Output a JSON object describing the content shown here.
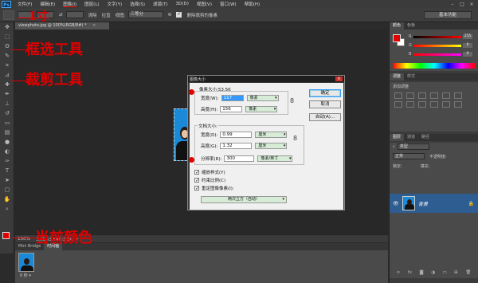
{
  "menubar": {
    "logo": "Ps",
    "items": [
      "文件(F)",
      "编辑(E)",
      "图像(I)",
      "图层(L)",
      "文字(Y)",
      "选择(S)",
      "滤镜(T)",
      "3D(D)",
      "视图(V)",
      "窗口(W)",
      "帮助(H)"
    ],
    "active_index": 2
  },
  "optbar": {
    "feather_label": "羽化:",
    "feather_value": "",
    "width_label": "",
    "clear_label": "清除",
    "straighten_label": "拉直",
    "view_label": "视图:",
    "view_value": "三等分",
    "delete_cropped_label": "删除裁剪的像素",
    "workspace": "基本功能"
  },
  "document": {
    "tab_title": "viewphoto.jpg @ 100%(RGB/8#) *",
    "close": "×"
  },
  "status": {
    "zoom": "100%",
    "info": "文档:53.5K/53.5K"
  },
  "mini_bridge": {
    "tabs": [
      "Mini Bridge",
      "时间轴"
    ],
    "thumb_label": "0 秒 ▾"
  },
  "right_panels": {
    "color_tabs": [
      "颜色",
      "色板"
    ],
    "sliders": [
      {
        "label": "R",
        "value": "255"
      },
      {
        "label": "G",
        "value": "0"
      },
      {
        "label": "B",
        "value": "0"
      }
    ],
    "adjust_tabs": [
      "调整",
      "样式"
    ],
    "adjust_title": "添加调整",
    "layers_tabs": [
      "图层",
      "通道",
      "路径"
    ],
    "kind_label": "类型",
    "blend_mode": "正常",
    "opacity_label": "不透明度:",
    "lock_label": "锁定:",
    "fill_label": "填充:",
    "layer_name": "背景",
    "layer_lock": "🔒"
  },
  "dialog": {
    "title": "图像大小",
    "close": "×",
    "pixel_size": "像素大小:53.5K",
    "width_label": "宽度(W):",
    "width_value": "117",
    "width_unit": "像素",
    "height_label": "高度(H):",
    "height_value": "156",
    "height_unit": "像素",
    "doc_size_label": "文档大小:",
    "doc_width_label": "宽度(D):",
    "doc_width_value": "0.99",
    "doc_width_unit": "厘米",
    "doc_height_label": "高度(G):",
    "doc_height_value": "1.32",
    "doc_height_unit": "厘米",
    "resolution_label": "分辨率(R):",
    "resolution_value": "300",
    "resolution_unit": "像素/英寸",
    "scale_styles": "缩放样式(Y)",
    "constrain": "约束比例(C)",
    "resample": "重定图像像素(I):",
    "resample_method": "两次立方（自动）",
    "ok": "确定",
    "cancel": "取消",
    "auto": "自动(A)..."
  },
  "annotations": {
    "a1": "1寸",
    "a2": "框选工具",
    "a3": "裁剪工具",
    "a4": "当前颜色"
  },
  "colors": {
    "accent_red": "#e00000",
    "layer_highlight": "#2e5d91",
    "photo_bg": "#1a8ad8"
  }
}
